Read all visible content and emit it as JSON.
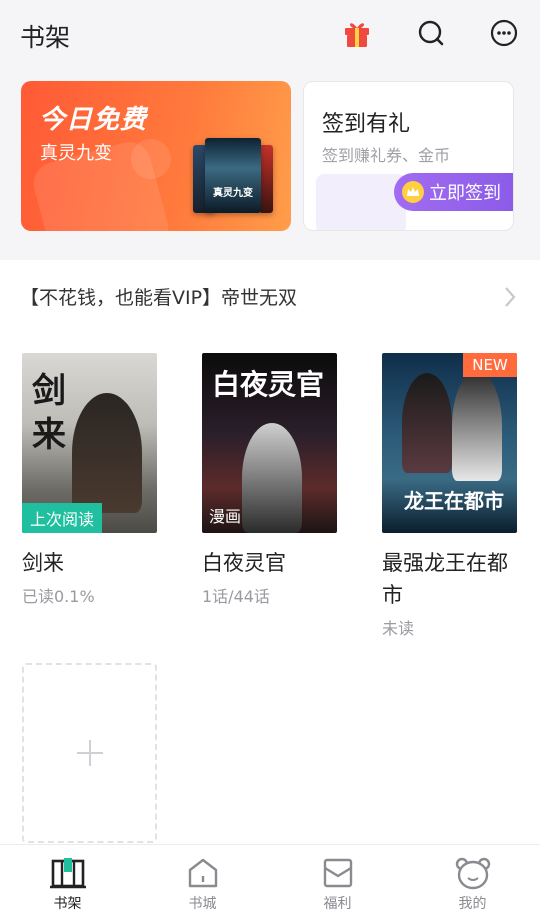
{
  "header": {
    "title": "书架"
  },
  "banner_free": {
    "title": "今日免费",
    "book": "真灵九变",
    "cover_text": "真灵九变"
  },
  "banner_sign": {
    "title": "签到有礼",
    "subtitle": "签到赚礼券、金币",
    "button": "立即签到"
  },
  "recommendation": {
    "text": "【不花钱，也能看VIP】帝世无双"
  },
  "books": [
    {
      "name": "剑来",
      "progress": "已读0.1%",
      "tag": "上次阅读",
      "cover_text": "剑来"
    },
    {
      "name": "白夜灵官",
      "progress": "1话/44话",
      "tag": "漫画",
      "cover_text": "白夜灵官"
    },
    {
      "name": "最强龙王在都市",
      "progress": "未读",
      "tag": "NEW",
      "cover_text": "龙王在都市"
    }
  ],
  "tabs": [
    {
      "label": "书架",
      "icon": "bookshelf-icon",
      "active": true
    },
    {
      "label": "书城",
      "icon": "home-icon",
      "active": false
    },
    {
      "label": "福利",
      "icon": "envelope-icon",
      "active": false
    },
    {
      "label": "我的",
      "icon": "bear-face-icon",
      "active": false
    }
  ],
  "colors": {
    "accent_orange": "#ff5a36",
    "accent_purple": "#9b67ee",
    "accent_green": "#1fbf9f",
    "gift_red": "#f04a3e"
  }
}
